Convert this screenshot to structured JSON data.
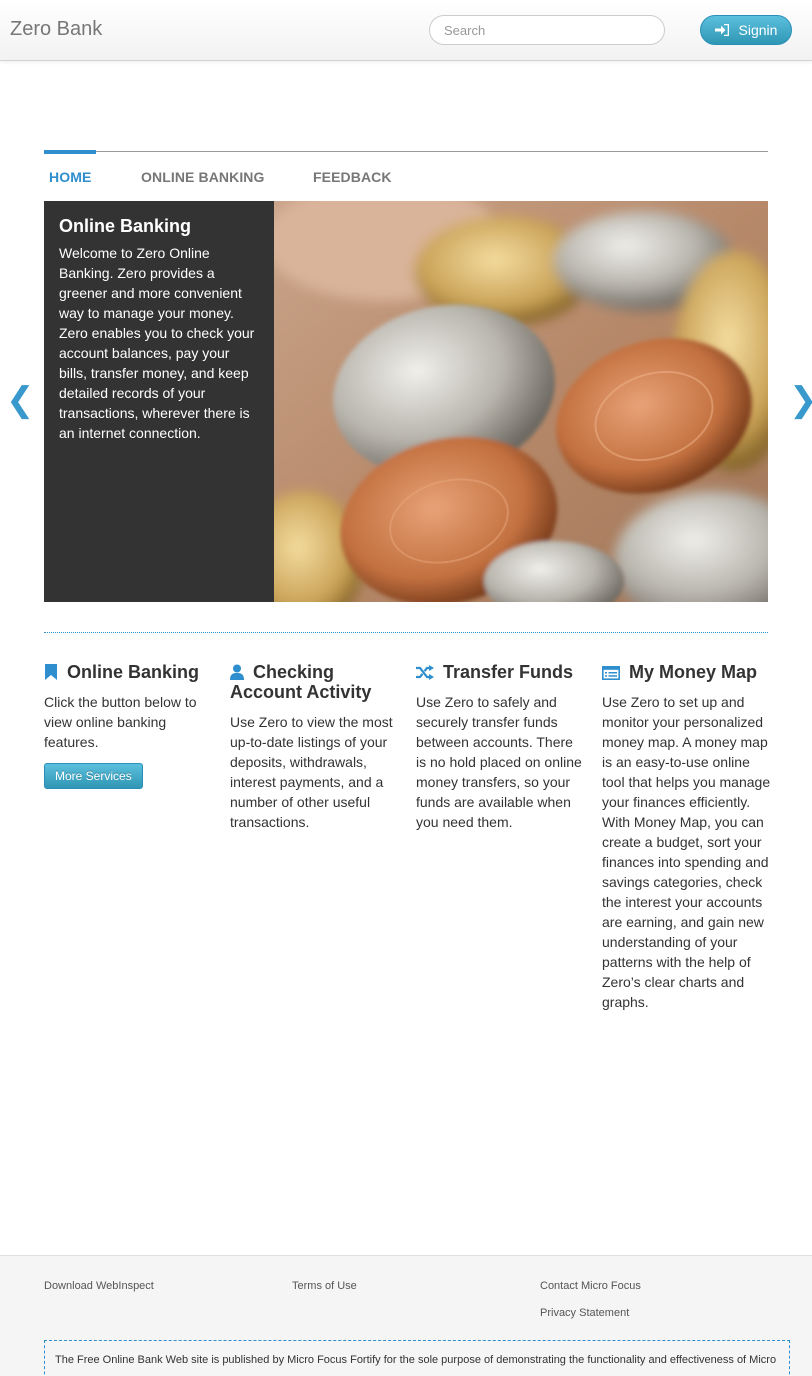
{
  "header": {
    "brand": "Zero Bank",
    "search_placeholder": "Search",
    "signin_label": "Signin",
    "signin_icon": "signin-arrow-icon"
  },
  "tabs": [
    {
      "label": "HOME",
      "active": true
    },
    {
      "label": "ONLINE BANKING",
      "active": false
    },
    {
      "label": "FEEDBACK",
      "active": false
    }
  ],
  "carousel": {
    "caption_title": "Online Banking",
    "caption_text": "Welcome to Zero Online Banking. Zero provides a greener and more convenient way to manage your money. Zero enables you to check your account balances, pay your bills, transfer money, and keep detailed records of your transactions, wherever there is an internet connection.",
    "prev_glyph": "❮",
    "next_glyph": "❯"
  },
  "features": [
    {
      "title": "Online Banking",
      "icon": "bookmark-icon",
      "text": "Click the button below to view online banking features.",
      "button": "More Services"
    },
    {
      "title": "Checking Account Activity",
      "icon": "user-icon",
      "text": "Use Zero to view the most up-to-date listings of your deposits, withdrawals, interest payments, and a number of other useful transactions."
    },
    {
      "title": "Transfer Funds",
      "icon": "shuffle-icon",
      "text": "Use Zero to safely and securely transfer funds between accounts. There is no hold placed on online money transfers, so your funds are available when you need them."
    },
    {
      "title": "My Money Map",
      "icon": "list-icon",
      "text": "Use Zero to set up and monitor your personalized money map. A money map is an easy-to-use online tool that helps you manage your finances efficiently. With Money Map, you can create a budget, sort your finances into spending and savings categories, check the interest your accounts are earning, and gain new understanding of your patterns with the help of Zero’s clear charts and graphs."
    }
  ],
  "footer": {
    "download": "Download WebInspect",
    "terms": "Terms of Use",
    "contact": "Contact Micro Focus",
    "privacy": "Privacy Statement",
    "disclaimer": "The Free Online Bank Web site is published by Micro Focus Fortify for the sole purpose of demonstrating the functionality and effectiveness of Micro"
  },
  "colors": {
    "accent": "#2e8ece",
    "caption_bg": "#333333",
    "button": "#49afcd"
  }
}
